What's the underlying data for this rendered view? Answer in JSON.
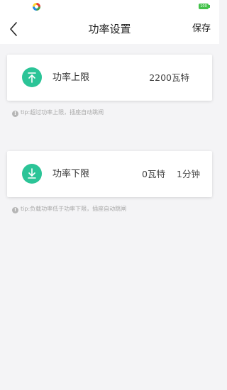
{
  "status_bar": {
    "battery": "100"
  },
  "header": {
    "title": "功率设置",
    "save_label": "保存"
  },
  "upper_limit": {
    "label": "功率上限",
    "value": "2200瓦特",
    "tip_icon": "!",
    "tip": "tip:超过功率上限，插座自动跳闸"
  },
  "lower_limit": {
    "label": "功率下限",
    "power_value": "0瓦特",
    "duration_value": "1分钟",
    "tip_icon": "!",
    "tip": "tip:负载功率低于功率下限，插座自动跳闸"
  },
  "icons": {
    "back": "chevron-left-icon",
    "upper": "arrow-up-to-line-icon",
    "lower": "arrow-down-to-line-icon",
    "info": "info-icon"
  },
  "colors": {
    "accent": "#2bc497",
    "battery": "#43c24a",
    "background": "#f4f4f6"
  }
}
